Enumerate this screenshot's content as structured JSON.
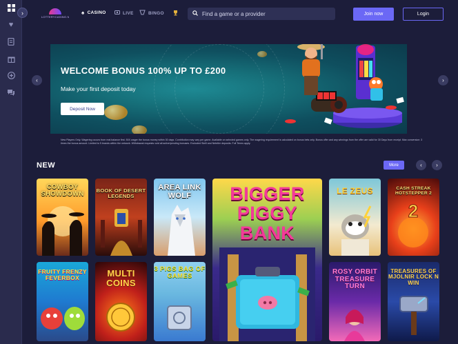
{
  "header": {
    "logo_text": "LOTTERYCASINO.NET",
    "nav": [
      {
        "label": "CASINO",
        "icon": "spade-icon"
      },
      {
        "label": "LIVE",
        "icon": "live-icon"
      },
      {
        "label": "BINGO",
        "icon": "bingo-icon"
      }
    ],
    "trophy_icon": "trophy-icon",
    "search": {
      "placeholder": "Find a game or a provider"
    },
    "join_label": "Join now",
    "login_label": "Login"
  },
  "sidebar": {
    "items": [
      "grid-icon",
      "heart-icon",
      "receipt-icon",
      "gift-icon",
      "plus-circle-icon",
      "chat-icon"
    ]
  },
  "banner": {
    "title": "WELCOME BONUS 100% UP TO £200",
    "subtitle": "Make your first deposit today",
    "cta": "Deposit Now"
  },
  "disclaimer": "New Players Only. Wagering occurs from real balance first. 50X wager the bonus money within 30 days. Contribution may vary per game. Available on selected games only. The wagering requirement is calculated on bonus bets only. Bonus offer and any winnings from the offer are valid for 30 Days from receipt. Max conversion: 3 times the bonus amount. Limited to 5 brands within the network. Withdrawal requests void all active/pending bonuses. Excluded Skrill and Neteller deposits. Full Terms apply.",
  "new_section": {
    "title": "NEW",
    "more_label": "More"
  },
  "games": [
    {
      "name": "COWBOY SHOWDOWN"
    },
    {
      "name": "BOOK OF DESERT LEGENDS"
    },
    {
      "name": "AREA LINK WOLF"
    },
    {
      "name": "BIGGER PIGGY BANK"
    },
    {
      "name": "LE ZEUS"
    },
    {
      "name": "CASH STREAK HOTSTEPPER 2"
    },
    {
      "name": "FRUITY FRENZY FEVERBOX"
    },
    {
      "name": "MULTI COINS"
    },
    {
      "name": "3 PIGS BAG OF GAMES"
    },
    {
      "name": "ROSY ORBIT TREASURE TURN"
    },
    {
      "name": "TREASURES OF MJOLNIR LOCK N WIN"
    }
  ]
}
